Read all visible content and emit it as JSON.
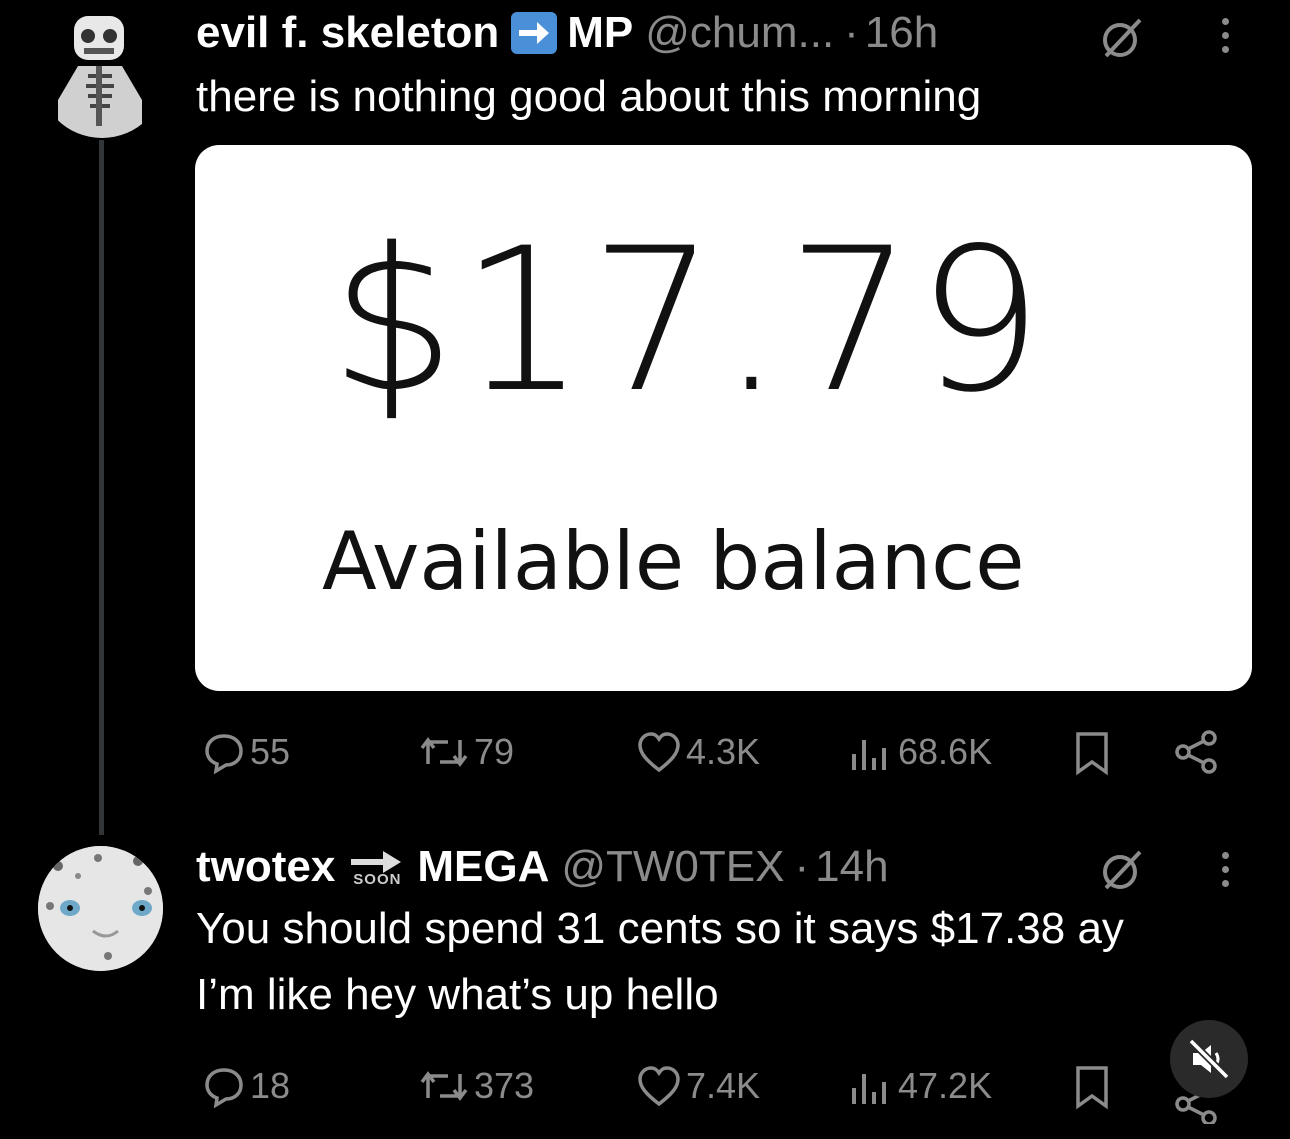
{
  "tweet1": {
    "display_name": "evil f. skeleton",
    "name_suffix": "MP",
    "handle": "@chum...",
    "separator": "·",
    "time": "16h",
    "text": "there is nothing good about this morning",
    "card": {
      "amount": "$17.79",
      "label": "Available balance"
    },
    "stats": {
      "replies": "55",
      "reposts": "79",
      "likes": "4.3K",
      "views": "68.6K"
    }
  },
  "tweet2": {
    "display_name": "twotex",
    "soon_label": "SOON",
    "name_suffix": "MEGA",
    "handle": "@TW0TEX",
    "separator": "·",
    "time": "14h",
    "text_line1": "You should spend 31 cents so it says $17.38 ay",
    "text_line2": "I’m like hey what’s up hello",
    "stats": {
      "replies": "18",
      "reposts": "373",
      "likes": "7.4K",
      "views": "47.2K"
    }
  },
  "colors": {
    "background": "#000000",
    "secondary_text": "#8b8b8b",
    "arrow_badge": "#4a90d9"
  },
  "icons": [
    "reply-icon",
    "repost-icon",
    "like-icon",
    "views-icon",
    "bookmark-icon",
    "share-icon",
    "grok-icon",
    "more-icon",
    "mute-icon"
  ]
}
